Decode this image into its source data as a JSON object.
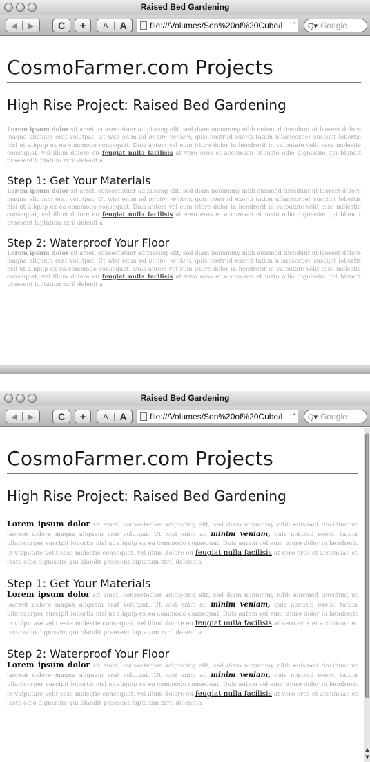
{
  "browser": {
    "window_title": "Raised Bed Gardening",
    "nav_back": "◀",
    "nav_forward": "▶",
    "reload": "C",
    "add_bookmark": "+",
    "text_smaller": "A",
    "text_bigger": "A",
    "url": "file:///Volumes/Son%20of%20Cube/l",
    "url_arrow": "⌃",
    "search_icon": "Q▾",
    "search_placeholder": "Google"
  },
  "page": {
    "site_title": "CosmoFarmer.com Projects",
    "heading": "High Rise Project: Raised Bed Gardening",
    "sections": [
      {
        "heading": ""
      },
      {
        "heading": "Step 1: Get Your Materials"
      },
      {
        "heading": "Step 2: Waterproof Your Floor"
      }
    ],
    "paragraph": {
      "lead": "Lorem ipsum dolor",
      "text_1": " sit amet, consectetuer adipiscing elit, sed diam nonummy nibh euismod tincidunt ut laoreet dolore magna aliquam erat volutpat. Ut wisi enim ad ",
      "emphasis": "minim veniam,",
      "text_2": " quis nostrud exerci tation ullamcorper suscipit lobortis nisl ut aliquip ex ea commodo consequat. Duis autem vel eum iriure dolor in hendrerit in vulputate velit esse molestie consequat, vel illum dolore eu ",
      "link": "feugiat nulla facilisis",
      "text_3": " at vero eros et accumsan et iusto odio dignissim qui blandit praesent luptatum zzril delenit a"
    }
  }
}
